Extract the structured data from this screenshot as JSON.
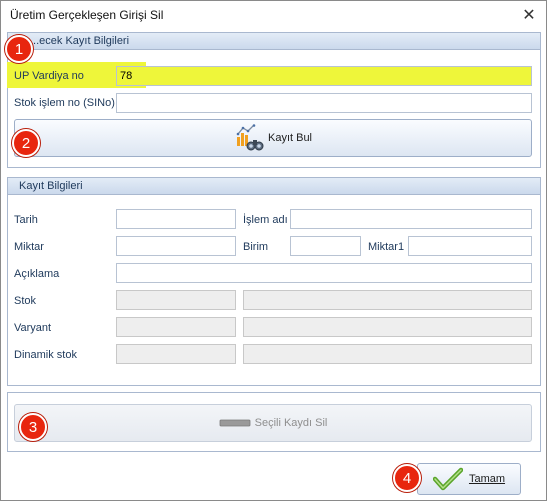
{
  "window": {
    "title": "Üretim Gerçekleşen Girişi Sil",
    "close_glyph": "✕"
  },
  "search_group": {
    "title": "...ecek Kayıt Bilgileri",
    "shift_label": "UP Vardiya no",
    "shift_value": "78",
    "stock_op_label": "Stok işlem no (SINo)",
    "stock_op_value": "",
    "find_button": "Kayıt Bul",
    "find_icon": "binoculars-chart-icon"
  },
  "record_group": {
    "title": "Kayıt Bilgileri",
    "date_label": "Tarih",
    "date_value": "",
    "operation_label": "İşlem adı",
    "operation_value": "",
    "quantity_label": "Miktar",
    "quantity_value": "",
    "unit_label": "Birim",
    "unit_value": "",
    "quantity1_label": "Miktar1",
    "quantity1_value": "",
    "description_label": "Açıklama",
    "description_value": "",
    "stock_label": "Stok",
    "variant_label": "Varyant",
    "dynamic_stock_label": "Dinamik stok"
  },
  "actions": {
    "delete_button": "Seçili Kaydı Sil",
    "delete_icon": "minus-icon",
    "ok_button": "Tamam",
    "ok_icon": "checkmark-icon"
  },
  "badges": [
    "1",
    "2",
    "3",
    "4"
  ],
  "colors": {
    "badge": "#e8260e",
    "highlight": "#eef63a",
    "group_border": "#a9b8cf",
    "label_text": "#1e395b",
    "check_green": "#5aa52b"
  }
}
